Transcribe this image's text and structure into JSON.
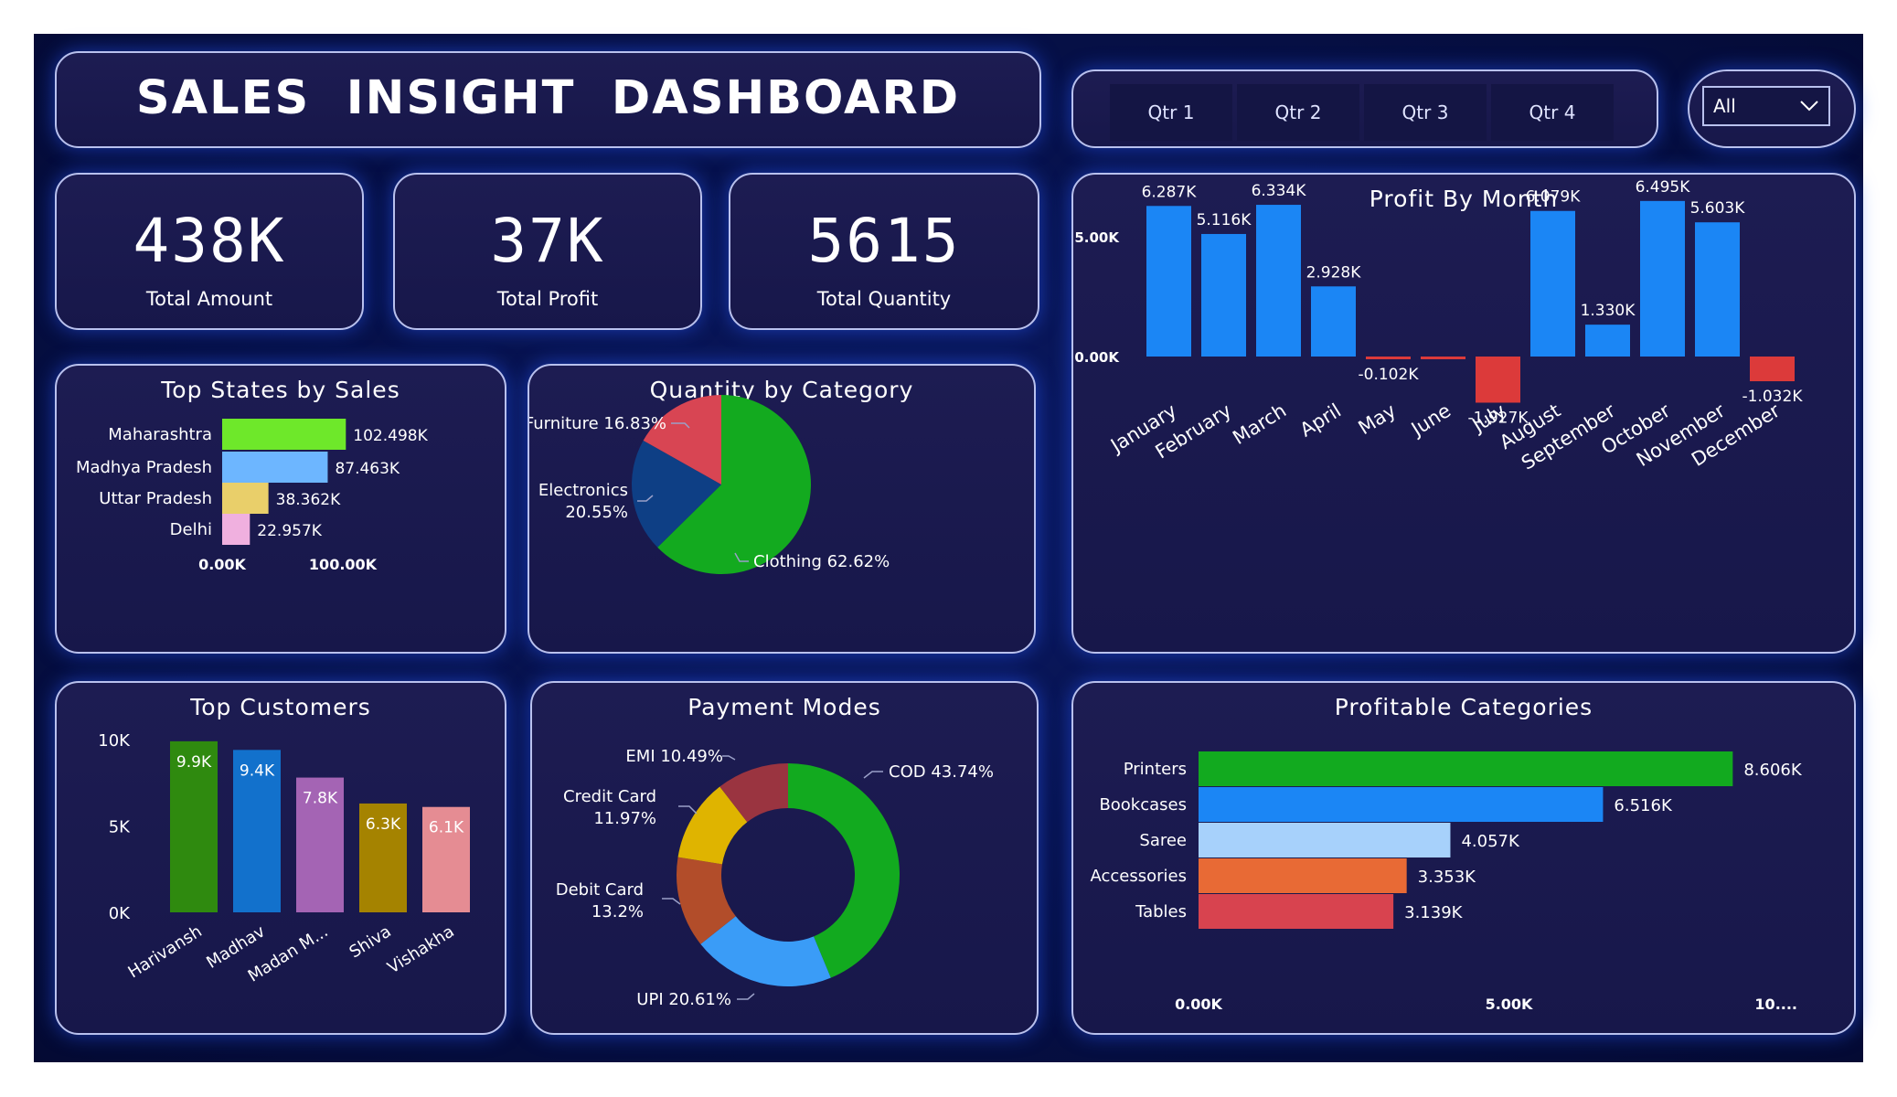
{
  "header": {
    "title": "SALES  INSIGHT  DASHBOARD"
  },
  "quarters": [
    "Qtr 1",
    "Qtr 2",
    "Qtr 3",
    "Qtr 4"
  ],
  "dropdown": {
    "selected": "All"
  },
  "kpis": [
    {
      "value": "438K",
      "label": "Total Amount"
    },
    {
      "value": "37K",
      "label": "Total Profit"
    },
    {
      "value": "5615",
      "label": "Total Quantity"
    }
  ],
  "chart_data": [
    {
      "id": "top_states",
      "type": "bar",
      "orientation": "horizontal",
      "title": "Top States by Sales",
      "categories": [
        "Maharashtra",
        "Madhya Pradesh",
        "Uttar Pradesh",
        "Delhi"
      ],
      "values": [
        102498,
        87463,
        38362,
        22957
      ],
      "labels": [
        "102.498K",
        "87.463K",
        "38.362K",
        "22.957K"
      ],
      "colors": [
        "#6ee82a",
        "#6db6ff",
        "#e9cf6a",
        "#f0b0df"
      ],
      "xlim": [
        0,
        100000
      ],
      "xticks": [
        "0.00K",
        "100.00K"
      ]
    },
    {
      "id": "quantity_category",
      "type": "pie",
      "title": "Quantity by Category",
      "slices": [
        {
          "name": "Clothing",
          "value": 62.62,
          "label": "Clothing 62.62%",
          "color": "#13aa1f"
        },
        {
          "name": "Electronics",
          "value": 20.55,
          "label": "Electronics 20.55%",
          "color": "#0e3f85"
        },
        {
          "name": "Furniture",
          "value": 16.83,
          "label": "Furniture 16.83%",
          "color": "#d84553"
        }
      ]
    },
    {
      "id": "profit_month",
      "type": "bar",
      "title": "Profit By Month",
      "categories": [
        "January",
        "February",
        "March",
        "April",
        "May",
        "June",
        "July",
        "August",
        "September",
        "October",
        "November",
        "December"
      ],
      "values": [
        6287,
        5116,
        6334,
        2928,
        -102,
        -100,
        -1927,
        6079,
        1330,
        6495,
        5603,
        -1032
      ],
      "labels": [
        "6.287K",
        "5.116K",
        "6.334K",
        "2.928K",
        "-0.102K",
        "",
        "-1.927K",
        "6.079K",
        "1.330K",
        "6.495K",
        "5.603K",
        "-1.032K"
      ],
      "positive_color": "#1b86f5",
      "negative_color": "#dc3a3a",
      "yticks": [
        "0.00K",
        "5.00K"
      ]
    },
    {
      "id": "top_customers",
      "type": "bar",
      "title": "Top Customers",
      "categories": [
        "Harivansh",
        "Madhav",
        "Madan M...",
        "Shiva",
        "Vishakha"
      ],
      "values": [
        9.9,
        9.4,
        7.8,
        6.3,
        6.1
      ],
      "labels": [
        "9.9K",
        "9.4K",
        "7.8K",
        "6.3K",
        "6.1K"
      ],
      "colors": [
        "#2f8a0f",
        "#1271cc",
        "#a464b4",
        "#a58300",
        "#e58c93"
      ],
      "ylim": [
        0,
        10
      ],
      "yticks": [
        "0K",
        "5K",
        "10K"
      ]
    },
    {
      "id": "payment_modes",
      "type": "pie",
      "title": "Payment Modes",
      "donut": true,
      "slices": [
        {
          "name": "COD",
          "value": 43.74,
          "label": "COD 43.74%",
          "color": "#12aa1f"
        },
        {
          "name": "UPI",
          "value": 20.61,
          "label": "UPI 20.61%",
          "color": "#3a9cf7"
        },
        {
          "name": "Debit Card",
          "value": 13.2,
          "label": "Debit Card 13.2%",
          "color": "#b24d2a"
        },
        {
          "name": "Credit Card",
          "value": 11.97,
          "label": "Credit Card 11.97%",
          "color": "#dfb400"
        },
        {
          "name": "EMI",
          "value": 10.49,
          "label": "EMI 10.49%",
          "color": "#9a3440"
        }
      ]
    },
    {
      "id": "profitable_categories",
      "type": "bar",
      "orientation": "horizontal",
      "title": "Profitable Categories",
      "categories": [
        "Printers",
        "Bookcases",
        "Saree",
        "Accessories",
        "Tables"
      ],
      "values": [
        8606,
        6516,
        4057,
        3353,
        3139
      ],
      "labels": [
        "8.606K",
        "6.516K",
        "4.057K",
        "3.353K",
        "3.139K"
      ],
      "colors": [
        "#12aa1f",
        "#1b86f5",
        "#a7d1fb",
        "#e86a35",
        "#d8434f"
      ],
      "xlim": [
        0,
        10000
      ],
      "xticks": [
        "0.00K",
        "5.00K",
        "10...."
      ]
    }
  ]
}
